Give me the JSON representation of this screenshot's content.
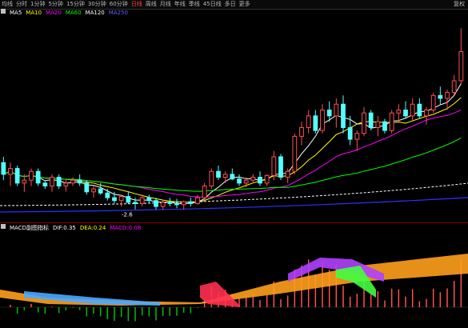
{
  "toolbar": {
    "items": [
      "分时",
      "1分钟",
      "5分钟",
      "15分钟",
      "30分钟",
      "60分钟",
      "日线",
      "周线",
      "月线",
      "年线",
      "季线",
      "45日线",
      "多日",
      "更多"
    ],
    "active_label": "日线",
    "prefix_label": "均线",
    "right_label": "复权"
  },
  "main_legend": {
    "title": "MA5",
    "label_ma10": "MA10",
    "label_ma20": "MA20",
    "label_ma60": "MA60",
    "label_ma120": "MA120",
    "label_ma250": "MA250"
  },
  "price_low_label": "-2.6",
  "indicator_legend": {
    "title": "MACD副图指标",
    "dif": "DIF:0.35",
    "dea": "DEA:0.24",
    "macd": "MACD:0.08"
  },
  "colors": {
    "up": "#ff5050",
    "down": "#54ffff",
    "ma5": "#ffffff",
    "ma10": "#ffff00",
    "ma20": "#ff00ff",
    "ma60": "#00ff00",
    "ma120": "#ffffff",
    "ma250": "#3030ff"
  },
  "chart_data": {
    "type": "candlestick",
    "candles": [
      [
        3.4,
        3.5,
        3.1,
        3.2
      ],
      [
        3.2,
        3.4,
        3.0,
        3.3
      ],
      [
        3.3,
        3.35,
        3.0,
        3.05
      ],
      [
        3.05,
        3.2,
        2.9,
        3.1
      ],
      [
        3.1,
        3.3,
        3.0,
        3.25
      ],
      [
        3.25,
        3.3,
        3.0,
        3.05
      ],
      [
        3.05,
        3.1,
        2.95,
        3.0
      ],
      [
        3.0,
        3.2,
        2.9,
        3.15
      ],
      [
        3.15,
        3.2,
        2.95,
        3.0
      ],
      [
        3.0,
        3.1,
        2.9,
        3.05
      ],
      [
        3.05,
        3.15,
        3.0,
        3.1
      ],
      [
        3.1,
        3.2,
        3.0,
        3.05
      ],
      [
        3.05,
        3.1,
        2.85,
        2.9
      ],
      [
        2.9,
        3.0,
        2.8,
        2.95
      ],
      [
        2.95,
        3.05,
        2.85,
        2.88
      ],
      [
        2.88,
        2.95,
        2.75,
        2.8
      ],
      [
        2.8,
        2.9,
        2.7,
        2.75
      ],
      [
        2.75,
        2.85,
        2.65,
        2.82
      ],
      [
        2.82,
        2.9,
        2.7,
        2.72
      ],
      [
        2.72,
        2.8,
        2.6,
        2.7
      ],
      [
        2.7,
        2.85,
        2.65,
        2.8
      ],
      [
        2.8,
        2.85,
        2.7,
        2.75
      ],
      [
        2.75,
        2.8,
        2.6,
        2.65
      ],
      [
        2.65,
        2.75,
        2.6,
        2.72
      ],
      [
        2.72,
        2.8,
        2.65,
        2.7
      ],
      [
        2.7,
        2.78,
        2.62,
        2.68
      ],
      [
        2.68,
        2.75,
        2.6,
        2.73
      ],
      [
        2.73,
        2.8,
        2.65,
        2.7
      ],
      [
        2.7,
        2.85,
        2.68,
        2.8
      ],
      [
        2.8,
        3.05,
        2.75,
        3.0
      ],
      [
        3.0,
        3.3,
        2.95,
        3.25
      ],
      [
        3.25,
        3.35,
        3.1,
        3.15
      ],
      [
        3.15,
        3.25,
        3.05,
        3.2
      ],
      [
        3.2,
        3.3,
        3.1,
        3.12
      ],
      [
        3.12,
        3.2,
        3.0,
        3.05
      ],
      [
        3.05,
        3.15,
        2.98,
        3.1
      ],
      [
        3.1,
        3.2,
        3.05,
        3.15
      ],
      [
        3.15,
        3.25,
        3.0,
        3.05
      ],
      [
        3.05,
        3.2,
        3.0,
        3.18
      ],
      [
        3.18,
        3.6,
        3.1,
        3.5
      ],
      [
        3.5,
        3.55,
        3.1,
        3.15
      ],
      [
        3.15,
        3.3,
        3.05,
        3.25
      ],
      [
        3.25,
        3.9,
        3.2,
        3.85
      ],
      [
        3.85,
        4.1,
        3.7,
        4.0
      ],
      [
        4.0,
        4.3,
        3.9,
        4.2
      ],
      [
        4.2,
        4.3,
        3.9,
        3.95
      ],
      [
        3.95,
        4.4,
        3.9,
        4.3
      ],
      [
        4.3,
        4.45,
        4.1,
        4.2
      ],
      [
        4.2,
        4.5,
        4.0,
        4.4
      ],
      [
        4.4,
        4.55,
        3.9,
        4.0
      ],
      [
        4.0,
        4.2,
        3.7,
        3.8
      ],
      [
        3.8,
        3.95,
        3.6,
        3.9
      ],
      [
        3.9,
        4.35,
        3.85,
        4.25
      ],
      [
        4.25,
        4.3,
        3.95,
        4.0
      ],
      [
        4.0,
        4.2,
        3.85,
        4.1
      ],
      [
        4.1,
        4.15,
        3.9,
        3.95
      ],
      [
        3.95,
        4.3,
        3.9,
        4.25
      ],
      [
        4.25,
        4.4,
        4.1,
        4.3
      ],
      [
        4.3,
        4.45,
        4.15,
        4.2
      ],
      [
        4.2,
        4.5,
        4.1,
        4.4
      ],
      [
        4.4,
        4.5,
        4.15,
        4.2
      ],
      [
        4.2,
        4.35,
        4.05,
        4.3
      ],
      [
        4.3,
        4.6,
        4.25,
        4.55
      ],
      [
        4.55,
        4.7,
        4.4,
        4.5
      ],
      [
        4.5,
        4.65,
        4.3,
        4.6
      ],
      [
        4.6,
        4.9,
        4.55,
        4.8
      ],
      [
        4.8,
        5.7,
        4.75,
        5.3
      ]
    ],
    "ylim": [
      2.5,
      5.8
    ]
  }
}
